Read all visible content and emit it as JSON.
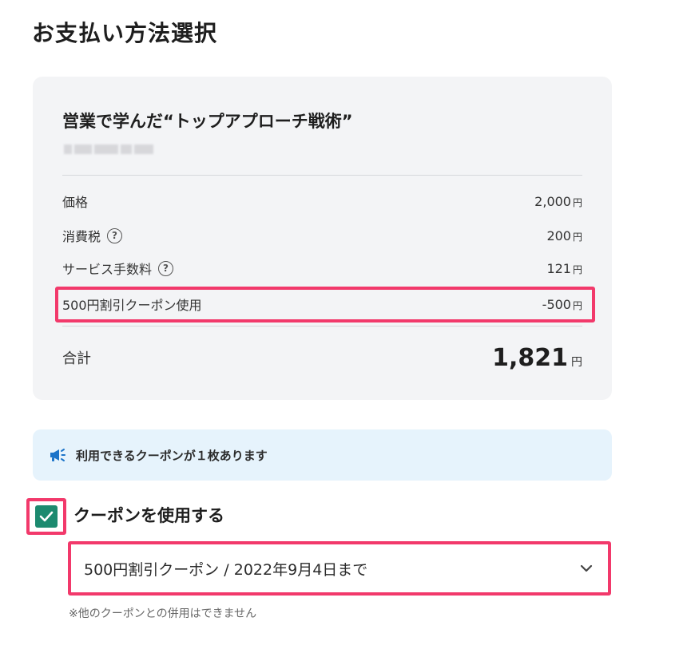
{
  "page": {
    "title": "お支払い方法選択"
  },
  "summary": {
    "product_title": "営業で学んだ“トップアプローチ戦術”",
    "rows": [
      {
        "label": "価格",
        "amount": "2,000",
        "unit": "円",
        "help": false
      },
      {
        "label": "消費税",
        "amount": "200",
        "unit": "円",
        "help": true
      },
      {
        "label": "サービス手数料",
        "amount": "121",
        "unit": "円",
        "help": true
      },
      {
        "label": "500円割引クーポン使用",
        "amount": "-500",
        "unit": "円",
        "help": false
      }
    ],
    "help_icon_glyph": "?",
    "total": {
      "label": "合計",
      "amount": "1,821",
      "unit": "円"
    }
  },
  "coupon_notice": {
    "text": "利用できるクーポンが１枚あります",
    "icon": "megaphone-icon"
  },
  "coupon_use": {
    "checked": true,
    "label": "クーポンを使用する",
    "selected_coupon": "500円割引クーポン / 2022年9月4日まで",
    "note": "※他のクーポンとの併用はできません"
  },
  "colors": {
    "highlight": "#f2396b",
    "checkbox": "#1c8a6f",
    "card_bg": "#f3f4f6",
    "notice_bg": "#e6f3fc",
    "megaphone": "#1a73c9"
  }
}
